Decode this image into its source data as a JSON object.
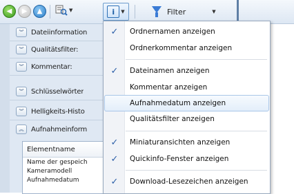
{
  "toolbar": {
    "back_icon": "back-arrow-icon",
    "forward_icon": "forward-arrow-icon",
    "up_icon": "up-arrow-icon",
    "view_icon": "view-options-icon",
    "info_icon": "info-icon",
    "filter_label": "Filter"
  },
  "panel": {
    "sections": [
      {
        "label": "Dateiinformation",
        "state": "collapsed"
      },
      {
        "label": "Qualitätsfilter:",
        "state": "collapsed"
      },
      {
        "label": "Kommentar:",
        "state": "collapsed"
      },
      {
        "label": "Schlüsselwörter",
        "state": "collapsed"
      },
      {
        "label": "Helligkeits-Histo",
        "state": "collapsed"
      },
      {
        "label": "Aufnahmeinform",
        "state": "expanded"
      }
    ],
    "table": {
      "header": "Elementname",
      "rows": [
        "Name der gespeich",
        "Kameramodell",
        "Aufnahmedatum"
      ]
    }
  },
  "menu": {
    "items": [
      {
        "label": "Ordnernamen anzeigen",
        "checked": true
      },
      {
        "label": "Ordnerkommentar anzeigen",
        "checked": false
      },
      {
        "label": "Dateinamen anzeigen",
        "checked": true
      },
      {
        "label": "Kommentar anzeigen",
        "checked": false
      },
      {
        "label": "Aufnahmedatum anzeigen",
        "checked": false,
        "highlighted": true
      },
      {
        "label": "Qualitätsfilter anzeigen",
        "checked": false
      },
      {
        "label": "Miniaturansichten anzeigen",
        "checked": true
      },
      {
        "label": "Quickinfo-Fenster anzeigen",
        "checked": true
      },
      {
        "label": "Download-Lesezeichen anzeigen",
        "checked": true
      }
    ],
    "check_glyph": "✓"
  }
}
